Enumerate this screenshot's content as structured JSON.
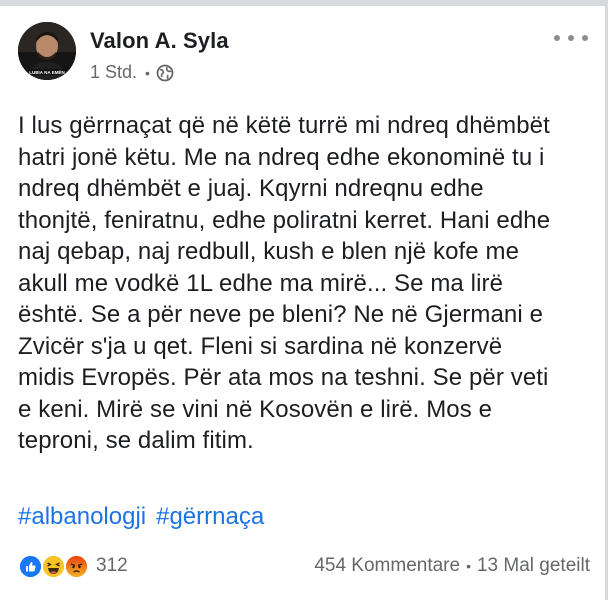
{
  "post": {
    "author": "Valon A. Syla",
    "time": "1 Std.",
    "time_separator": "•",
    "privacy_icon": "globe-icon",
    "avatar_caption": "LUBIA NA EMËN",
    "text_lines": [
      "I lus gërrnaçat që në këtë turrë mi ndreq dhëmbët",
      "hatri jonë këtu. Me na ndreq edhe ekonominë tu i",
      "ndreq dhëmbët e juaj. Kqyrni ndreqnu edhe",
      "thonjtë, feniratnu, edhe poliratni kerret. Hani edhe",
      "naj qebap, naj redbull, kush e blen një kofe me",
      "akull me vodkë 1L edhe ma mirë... Se ma lirë",
      "është. Se a për neve pe bleni? Ne në Gjermani e",
      "Zvicër s'ja u qet. Fleni si sardina në konzervë",
      "midis Evropës. Për ata mos na teshni. Se për veti",
      "e keni. Mirë se vini në Kosovën e lirë. Mos e",
      "tepronі, se dalim fitim."
    ],
    "hashtags": [
      "#albanologji",
      "#gërrnaça"
    ]
  },
  "footer": {
    "reaction_icons": [
      "like-icon",
      "haha-icon",
      "angry-icon"
    ],
    "reaction_count": "312",
    "comments": "454 Kommentare",
    "separator": "•",
    "shares": "13 Mal geteilt"
  },
  "colors": {
    "link": "#1b74e4",
    "secondary_text": "#65676b",
    "like": "#1877f2",
    "haha": "#f7b125",
    "angry": "#e9710f"
  }
}
